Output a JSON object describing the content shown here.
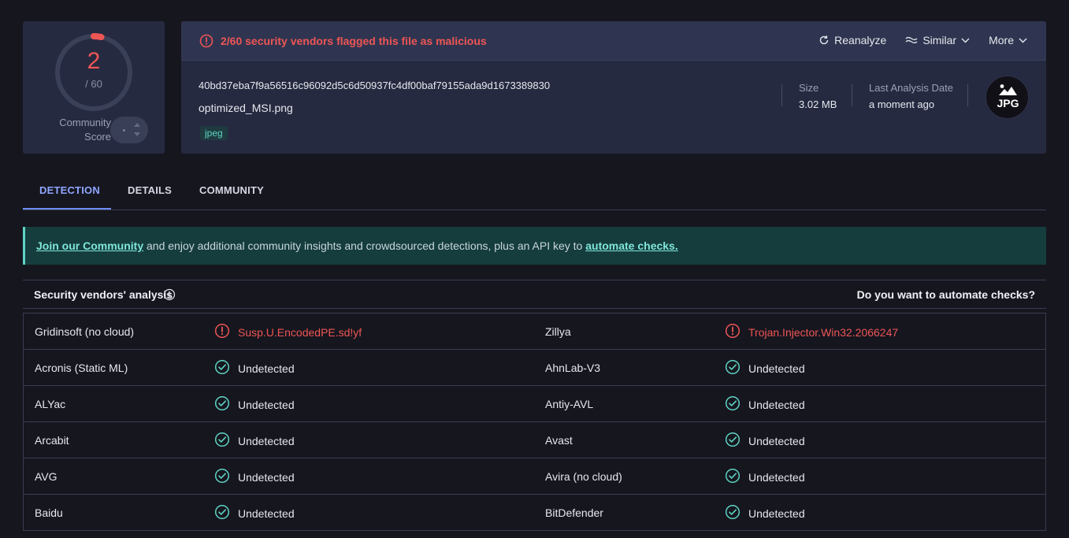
{
  "score": {
    "detected": "2",
    "total": "/ 60",
    "fraction": 0.0333,
    "community_label_line1": "Community",
    "community_label_line2": "Score"
  },
  "header": {
    "alert": "2/60 security vendors flagged this file as malicious",
    "actions": {
      "reanalyze": "Reanalyze",
      "similar": "Similar",
      "more": "More"
    }
  },
  "file": {
    "hash": "40bd37eba7f9a56516c96092d5c6d50937fc4df00baf79155ada9d1673389830",
    "name": "optimized_MSI.png",
    "tag": "jpeg",
    "size_label": "Size",
    "size_value": "3.02 MB",
    "date_label": "Last Analysis Date",
    "date_value": "a moment ago",
    "type_badge": "JPG"
  },
  "tabs": [
    "DETECTION",
    "DETAILS",
    "COMMUNITY"
  ],
  "banner": {
    "link1": "Join our Community",
    "middle": " and enjoy additional community insights and crowdsourced detections, plus an API key to ",
    "link2": "automate checks."
  },
  "section": {
    "title": "Security vendors' analysis",
    "right": "Do you want to automate checks?"
  },
  "vendors": [
    {
      "left": {
        "name": "Gridinsoft (no cloud)",
        "result": "Susp.U.EncodedPE.sd!yf",
        "status": "malicious"
      },
      "right": {
        "name": "Zillya",
        "result": "Trojan.Injector.Win32.2066247",
        "status": "malicious"
      }
    },
    {
      "left": {
        "name": "Acronis (Static ML)",
        "result": "Undetected",
        "status": "clean"
      },
      "right": {
        "name": "AhnLab-V3",
        "result": "Undetected",
        "status": "clean"
      }
    },
    {
      "left": {
        "name": "ALYac",
        "result": "Undetected",
        "status": "clean"
      },
      "right": {
        "name": "Antiy-AVL",
        "result": "Undetected",
        "status": "clean"
      }
    },
    {
      "left": {
        "name": "Arcabit",
        "result": "Undetected",
        "status": "clean"
      },
      "right": {
        "name": "Avast",
        "result": "Undetected",
        "status": "clean"
      }
    },
    {
      "left": {
        "name": "AVG",
        "result": "Undetected",
        "status": "clean"
      },
      "right": {
        "name": "Avira (no cloud)",
        "result": "Undetected",
        "status": "clean"
      }
    },
    {
      "left": {
        "name": "Baidu",
        "result": "Undetected",
        "status": "clean"
      },
      "right": {
        "name": "BitDefender",
        "result": "Undetected",
        "status": "clean"
      }
    }
  ],
  "colors": {
    "malicious": "#ee5555",
    "clean": "#5fd4c4",
    "accent": "#6f8cff"
  }
}
